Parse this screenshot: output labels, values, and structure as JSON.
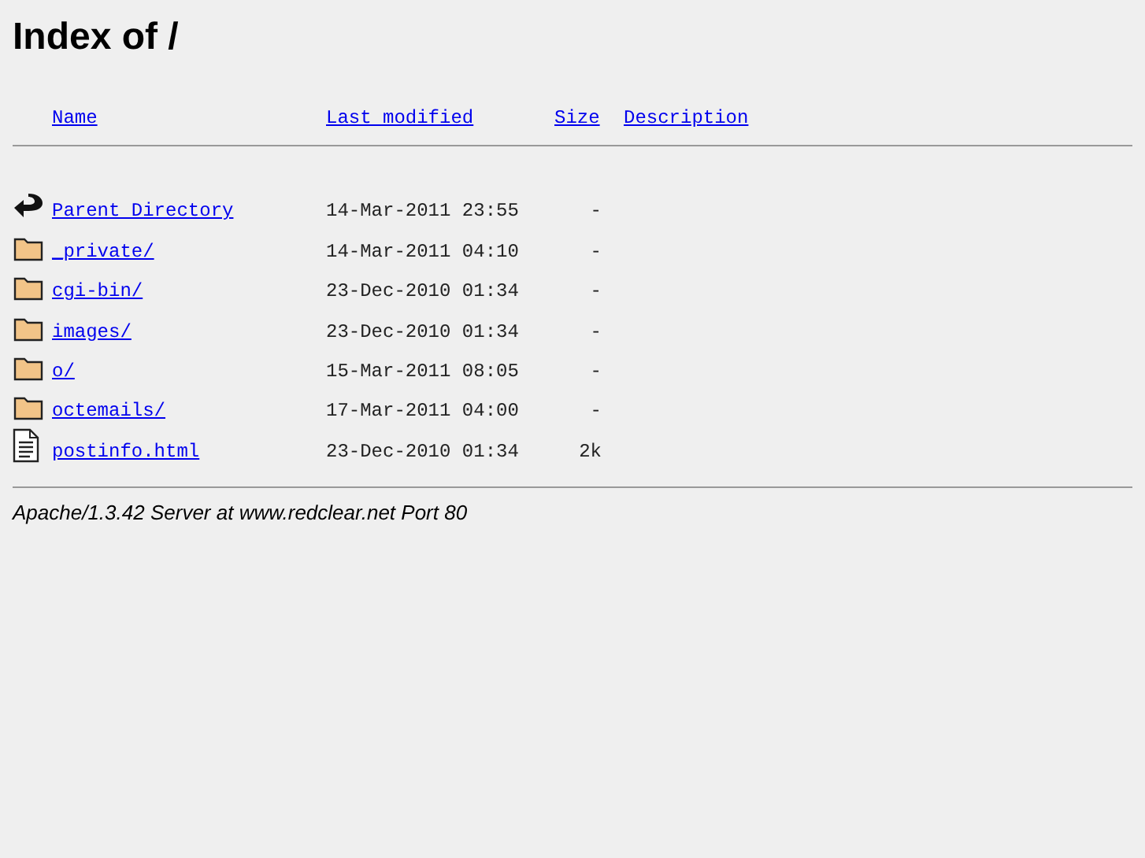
{
  "title": "Index of /",
  "columns": [
    "Name",
    "Last modified",
    "Size",
    "Description"
  ],
  "rows": [
    {
      "kind": "parent",
      "name": "Parent Directory",
      "modified": "14-Mar-2011 23:55",
      "size": "-"
    },
    {
      "kind": "folder",
      "name": "_private/",
      "modified": "14-Mar-2011 04:10",
      "size": "-"
    },
    {
      "kind": "folder",
      "name": "cgi-bin/",
      "modified": "23-Dec-2010 01:34",
      "size": "-"
    },
    {
      "kind": "folder",
      "name": "images/",
      "modified": "23-Dec-2010 01:34",
      "size": "-"
    },
    {
      "kind": "folder",
      "name": "o/",
      "modified": "15-Mar-2011 08:05",
      "size": "-"
    },
    {
      "kind": "folder",
      "name": "octemails/",
      "modified": "17-Mar-2011 04:00",
      "size": "-"
    },
    {
      "kind": "file",
      "name": "postinfo.html",
      "modified": "23-Dec-2010 01:34",
      "size": "2k"
    }
  ],
  "footer": "Apache/1.3.42 Server at www.redclear.net Port 80"
}
